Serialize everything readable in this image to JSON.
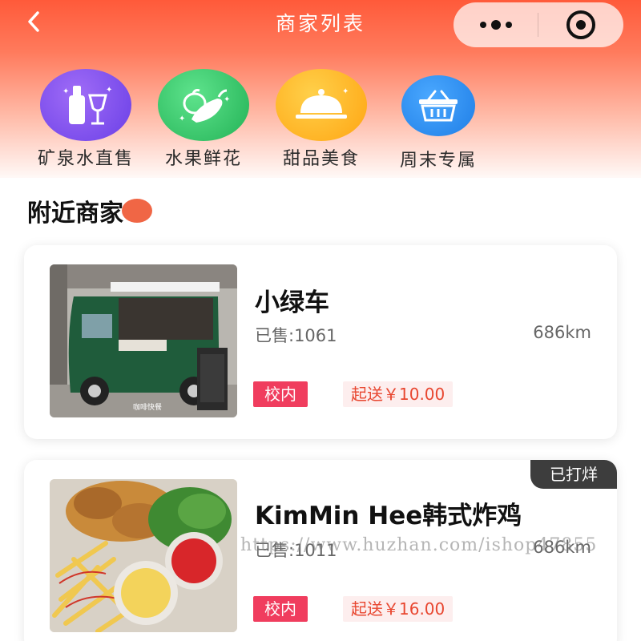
{
  "nav": {
    "title": "商家列表",
    "back_icon": "chevron-left-icon",
    "more_icon": "more-dots-icon",
    "close_icon": "target-circle-icon"
  },
  "categories": [
    {
      "label": "矿泉水直售",
      "icon": "bottle-glass-icon",
      "color": "#7b52f0"
    },
    {
      "label": "水果鲜花",
      "icon": "vegetable-icon",
      "color": "#33c46a"
    },
    {
      "label": "甜品美食",
      "icon": "cloche-dish-icon",
      "color": "#ffb020"
    },
    {
      "label": "周末专属",
      "icon": "basket-icon",
      "color": "#2f8ff0"
    }
  ],
  "section": {
    "title": "附近商家"
  },
  "shops": [
    {
      "name": "小绿车",
      "sold": "已售:1061",
      "distance": "686km",
      "tag": "校内",
      "min_order": "起送￥10.00",
      "ribbon": "",
      "thumb_caption": "咖啡快餐"
    },
    {
      "name": "KimMin Hee韩式炸鸡",
      "sold": "已售:1011",
      "distance": "686km",
      "tag": "校内",
      "min_order": "起送￥16.00",
      "ribbon": "已打烊"
    }
  ],
  "watermark": "https://www.huzhan.com/ishop47855",
  "colors": {
    "header_top": "#ff5a3a",
    "campus_tag": "#f03d5e",
    "min_order_text": "#e8462f",
    "ribbon_bg": "#3d3d3d"
  }
}
